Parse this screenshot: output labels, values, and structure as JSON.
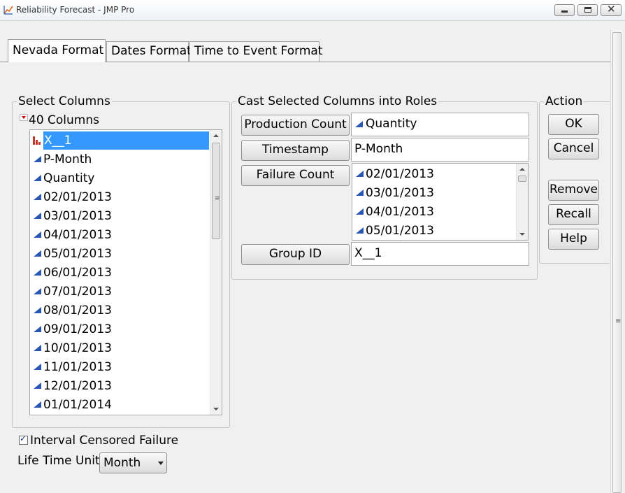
{
  "window": {
    "title": "Reliability Forecast - JMP Pro",
    "controls": {
      "minimize": "minimize-icon",
      "maximize": "maximize-icon",
      "close": "✕"
    }
  },
  "tabs": [
    {
      "label": "Nevada Format",
      "active": true
    },
    {
      "label": "Dates Format",
      "active": false
    },
    {
      "label": "Time to Event Format",
      "active": false
    }
  ],
  "select_columns": {
    "title": "Select Columns",
    "count_label": "40 Columns",
    "items": [
      {
        "label": "X__1",
        "icon": "nominal-bar-icon",
        "selected": true
      },
      {
        "label": "P-Month",
        "icon": "continuous-icon"
      },
      {
        "label": "Quantity",
        "icon": "continuous-icon"
      },
      {
        "label": "02/01/2013",
        "icon": "continuous-icon"
      },
      {
        "label": "03/01/2013",
        "icon": "continuous-icon"
      },
      {
        "label": "04/01/2013",
        "icon": "continuous-icon"
      },
      {
        "label": "05/01/2013",
        "icon": "continuous-icon"
      },
      {
        "label": "06/01/2013",
        "icon": "continuous-icon"
      },
      {
        "label": "07/01/2013",
        "icon": "continuous-icon"
      },
      {
        "label": "08/01/2013",
        "icon": "continuous-icon"
      },
      {
        "label": "09/01/2013",
        "icon": "continuous-icon"
      },
      {
        "label": "10/01/2013",
        "icon": "continuous-icon"
      },
      {
        "label": "11/01/2013",
        "icon": "continuous-icon"
      },
      {
        "label": "12/01/2013",
        "icon": "continuous-icon"
      },
      {
        "label": "01/01/2014",
        "icon": "continuous-icon"
      }
    ]
  },
  "cast": {
    "title": "Cast Selected Columns into Roles",
    "production_count": {
      "button": "Production Count",
      "value": "Quantity"
    },
    "timestamp": {
      "button": "Timestamp",
      "value": "P-Month"
    },
    "failure_count": {
      "button": "Failure Count",
      "values": [
        "02/01/2013",
        "03/01/2013",
        "04/01/2013",
        "05/01/2013"
      ]
    },
    "group_id": {
      "button": "Group ID",
      "value": "X__1"
    }
  },
  "action": {
    "title": "Action",
    "ok": "OK",
    "cancel": "Cancel",
    "remove": "Remove",
    "recall": "Recall",
    "help": "Help"
  },
  "options": {
    "interval_censored": {
      "label": "Interval Censored Failure",
      "checked": true
    },
    "life_time_unit": {
      "label": "Life Time Unit",
      "value": "Month"
    }
  },
  "colors": {
    "selection": "#3399ff",
    "continuous_icon": "#2a56b3",
    "nominal_icon": "#c0392b",
    "disclosure": "#d00000"
  }
}
